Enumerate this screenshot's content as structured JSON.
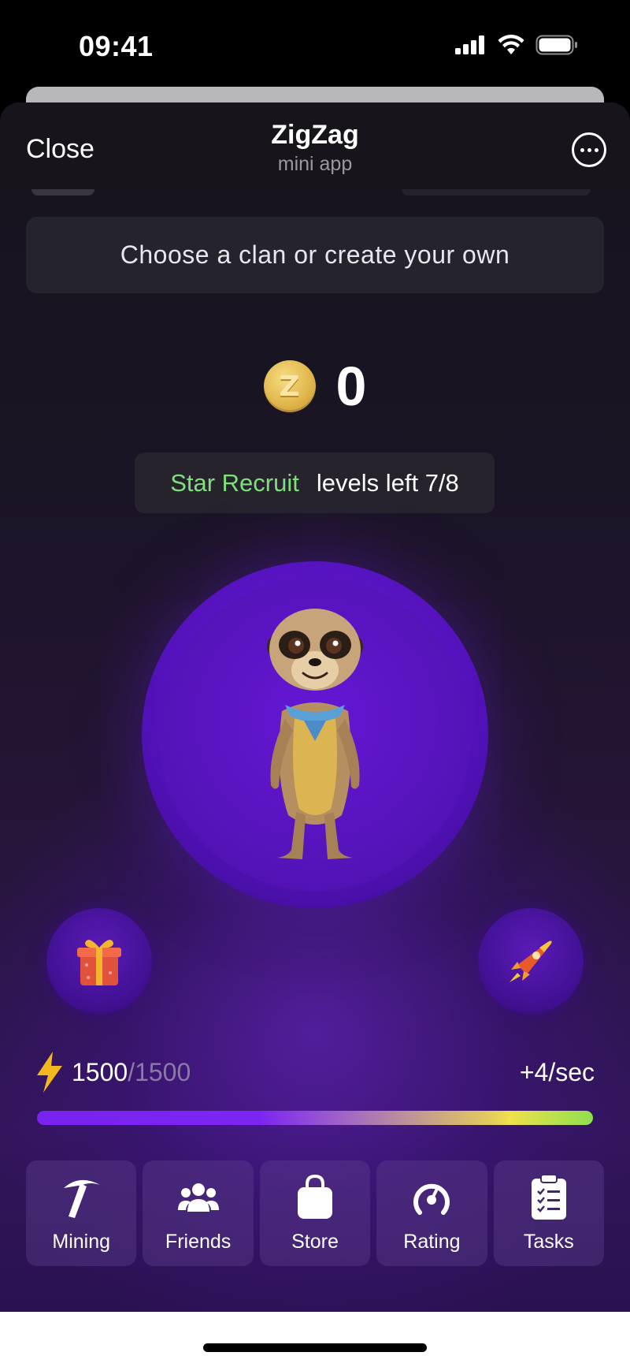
{
  "status_bar": {
    "time": "09:41"
  },
  "header": {
    "close_label": "Close",
    "title": "ZigZag",
    "subtitle": "mini app"
  },
  "clan_banner": {
    "text": "Choose a clan or create your own"
  },
  "balance": {
    "coin_letter": "Z",
    "value": "0"
  },
  "level": {
    "name": "Star Recruit",
    "progress": "levels left 7/8"
  },
  "energy": {
    "current": "1500",
    "max": "/1500",
    "rate": "+4/sec",
    "fill": 1.0
  },
  "nav": {
    "items": [
      {
        "label": "Mining",
        "icon": "pickaxe-icon"
      },
      {
        "label": "Friends",
        "icon": "friends-icon"
      },
      {
        "label": "Store",
        "icon": "shopping-bag-icon"
      },
      {
        "label": "Rating",
        "icon": "gauge-icon"
      },
      {
        "label": "Tasks",
        "icon": "clipboard-icon"
      }
    ]
  },
  "colors": {
    "accent": "#6a1ed6",
    "level_green": "#7ee07a",
    "coin": "#e2b74e",
    "energy_bolt": "#f2b81e"
  }
}
